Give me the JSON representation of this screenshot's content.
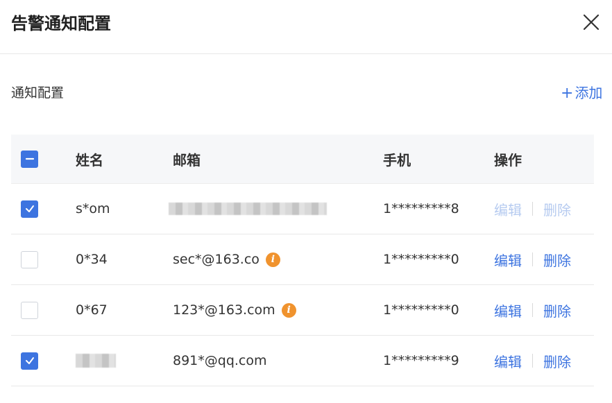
{
  "dialog": {
    "title": "告警通知配置",
    "close_label": "×"
  },
  "section": {
    "title": "通知配置",
    "add_plus": "+",
    "add_label": "添加"
  },
  "table": {
    "columns": [
      "姓名",
      "邮箱",
      "手机",
      "操作"
    ],
    "rows": [
      {
        "checked": true,
        "name": "s*om",
        "name_redacted": false,
        "email": "",
        "email_redacted": true,
        "email_warning": false,
        "phone": "1*********8",
        "edit": "编辑",
        "delete": "删除",
        "ops_disabled": true
      },
      {
        "checked": false,
        "name": "0*34",
        "name_redacted": false,
        "email": "sec*@163.co",
        "email_redacted": false,
        "email_warning": true,
        "phone": "1*********0",
        "edit": "编辑",
        "delete": "删除",
        "ops_disabled": false
      },
      {
        "checked": false,
        "name": "0*67",
        "name_redacted": false,
        "email": "123*@163.com",
        "email_redacted": false,
        "email_warning": true,
        "phone": "1*********0",
        "edit": "编辑",
        "delete": "删除",
        "ops_disabled": false
      },
      {
        "checked": true,
        "name": "",
        "name_redacted": true,
        "email": "891*@qq.com",
        "email_redacted": false,
        "email_warning": false,
        "phone": "1*********9",
        "edit": "编辑",
        "delete": "删除",
        "ops_disabled": false
      }
    ]
  },
  "colors": {
    "accent": "#3d74e0",
    "accent_disabled": "#b6cbf0",
    "warning": "#f0932e",
    "header_bg": "#f6f7f9"
  },
  "icons": {
    "close": "close-icon",
    "info": "info-icon",
    "check": "checkmark-icon",
    "indeterminate": "minus-icon"
  }
}
